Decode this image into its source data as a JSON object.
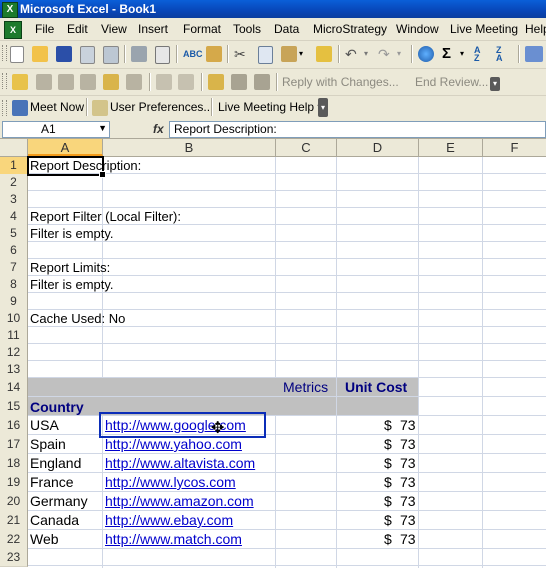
{
  "window": {
    "title": "Microsoft Excel - Book1"
  },
  "menu": [
    "File",
    "Edit",
    "View",
    "Insert",
    "Format",
    "Tools",
    "Data",
    "MicroStrategy",
    "Window",
    "Live Meeting",
    "Help"
  ],
  "toolbar2": {
    "reply_label": "Reply with Changes...",
    "end_review_label": "End Review..."
  },
  "toolbar3": {
    "meet_now_label": "Meet Now",
    "user_prefs_label": "User Preferences...",
    "live_meeting_help_label": "Live Meeting Help ▾"
  },
  "formula_bar": {
    "name_box": "A1",
    "fx_label": "fx",
    "value": "Report Description:"
  },
  "columns": [
    "A",
    "B",
    "C",
    "D",
    "E",
    "F"
  ],
  "rows": [
    "1",
    "2",
    "3",
    "4",
    "5",
    "6",
    "7",
    "8",
    "9",
    "10",
    "11",
    "12",
    "13",
    "14",
    "15",
    "16",
    "17",
    "18",
    "19",
    "20",
    "21",
    "22",
    "23"
  ],
  "report": {
    "description": "Report Description:",
    "filter_label": "Report Filter (Local Filter):",
    "filter_value": "Filter is empty.",
    "limits_label": "Report Limits:",
    "limits_value": "Filter is empty.",
    "cache_used": "Cache Used: No",
    "metrics_label": "Metrics",
    "unit_cost_label": "Unit Cost",
    "country_label": "Country",
    "data_rows": [
      {
        "country": "USA",
        "url": "http://www.google.com",
        "currency": "$",
        "cost": "73"
      },
      {
        "country": "Spain",
        "url": "http://www.yahoo.com",
        "currency": "$",
        "cost": "73"
      },
      {
        "country": "England",
        "url": "http://www.altavista.com",
        "currency": "$",
        "cost": "73"
      },
      {
        "country": "France",
        "url": "http://www.lycos.com",
        "currency": "$",
        "cost": "73"
      },
      {
        "country": "Germany",
        "url": "http://www.amazon.com",
        "currency": "$",
        "cost": "73"
      },
      {
        "country": "Canada",
        "url": "http://www.ebay.com",
        "currency": "$",
        "cost": "73"
      },
      {
        "country": "Web",
        "url": "http://www.match.com",
        "currency": "$",
        "cost": "73"
      }
    ]
  },
  "colors": {
    "header_navy": "#000080",
    "link_blue": "#0000cc",
    "selection_orange": "#f9d67c",
    "band_grey": "#c0c0c0"
  }
}
